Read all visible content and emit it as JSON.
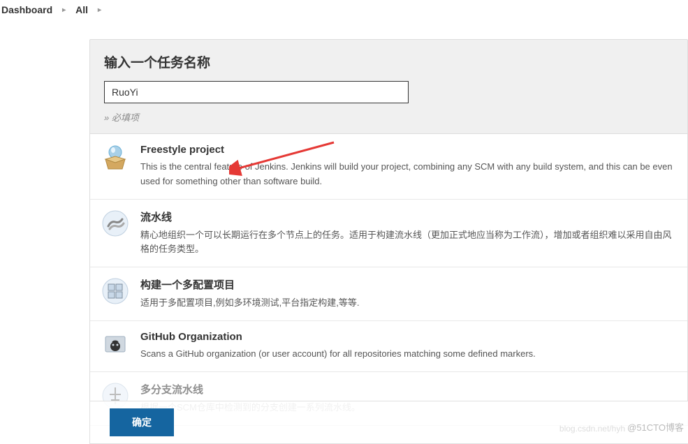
{
  "breadcrumb": {
    "items": [
      "Dashboard",
      "All"
    ]
  },
  "header": {
    "title": "输入一个任务名称",
    "input_value": "RuoYi",
    "required_hint": "» 必填项"
  },
  "items": [
    {
      "title": "Freestyle project",
      "desc": "This is the central feature of Jenkins. Jenkins will build your project, combining any SCM with any build system, and this can be even used for something other than software build.",
      "icon": "freestyle"
    },
    {
      "title": "流水线",
      "desc": "精心地组织一个可以长期运行在多个节点上的任务。适用于构建流水线（更加正式地应当称为工作流），增加或者组织难以采用自由风格的任务类型。",
      "icon": "pipeline"
    },
    {
      "title": "构建一个多配置项目",
      "desc": "适用于多配置项目,例如多环境测试,平台指定构建,等等.",
      "icon": "multiconfig"
    },
    {
      "title": "GitHub Organization",
      "desc": "Scans a GitHub organization (or user account) for all repositories matching some defined markers.",
      "icon": "github"
    },
    {
      "title": "多分支流水线",
      "desc": "根据一个SCM仓库中检测到的分支创建一系列流水线。",
      "icon": "multibranch"
    }
  ],
  "ok_button": "确定",
  "watermark": "@51CTO博客"
}
